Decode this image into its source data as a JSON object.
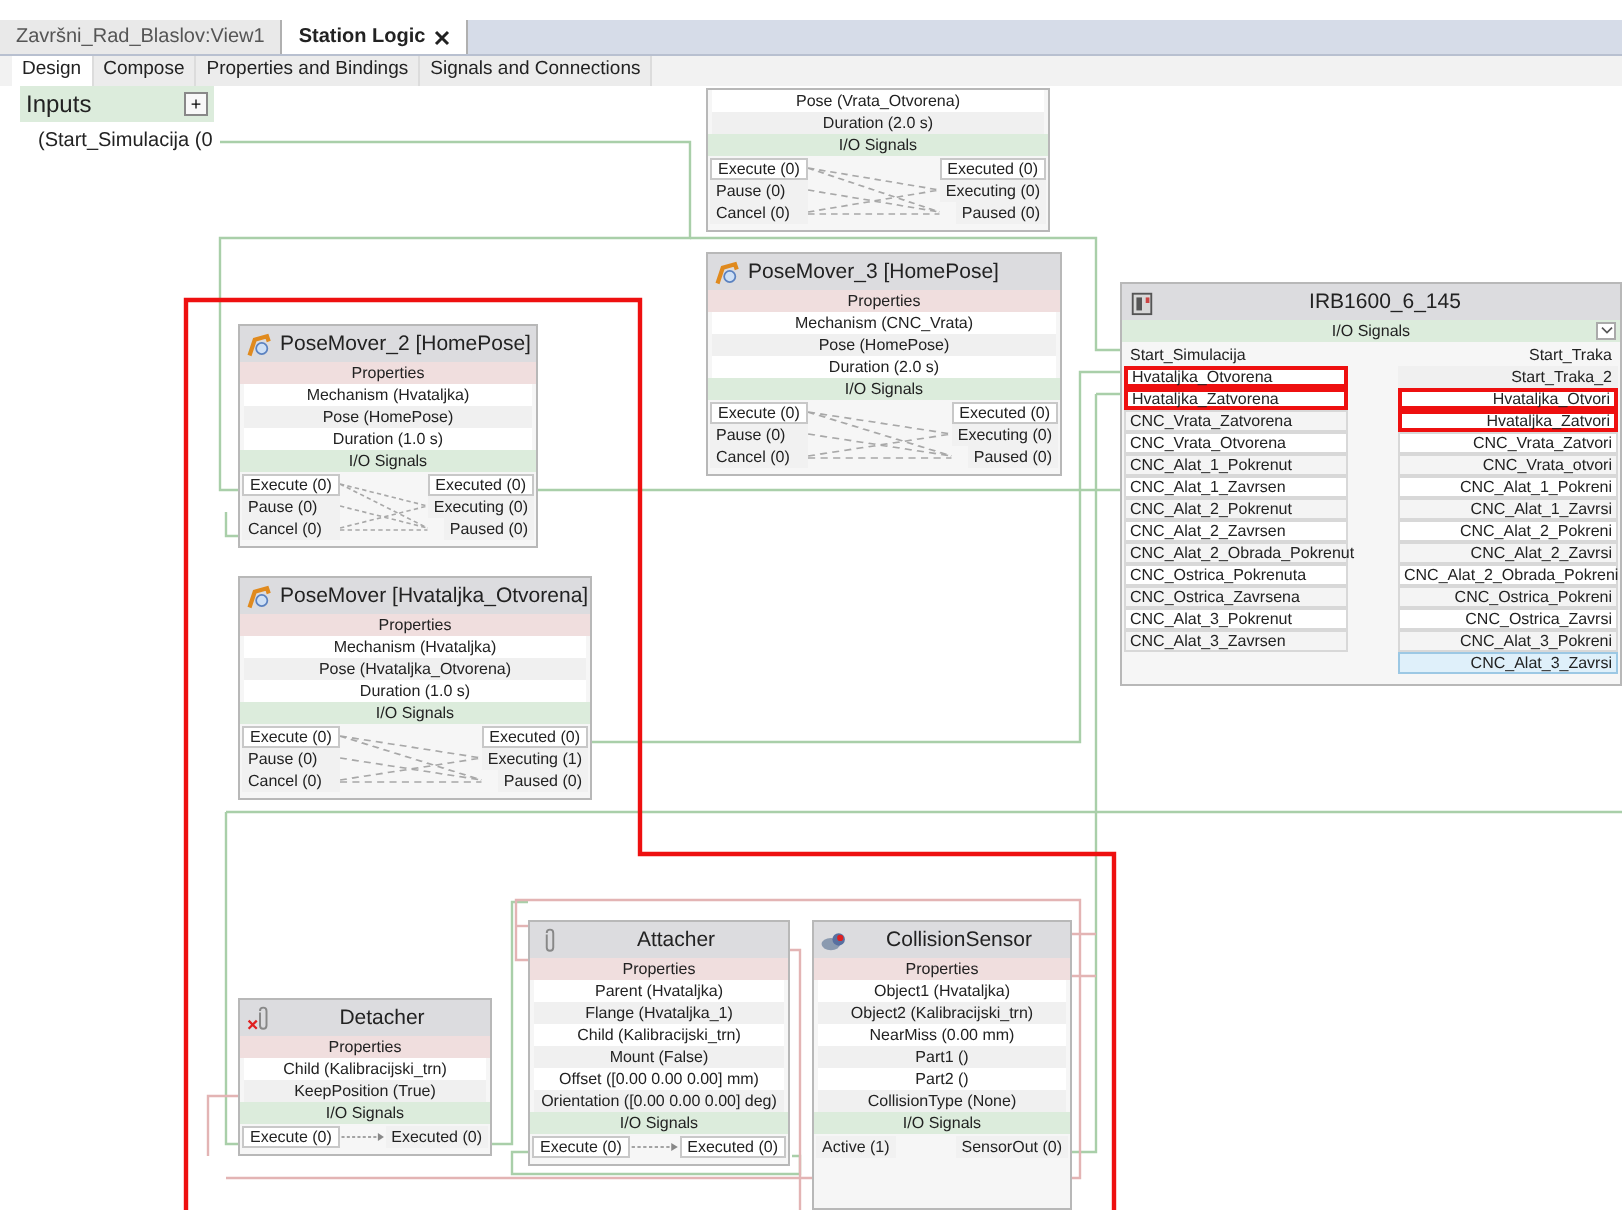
{
  "document_tabs": [
    {
      "label": "Završni_Rad_Blaslov:View1",
      "selected": false
    },
    {
      "label": "Station Logic",
      "selected": true
    }
  ],
  "view_tabs": [
    {
      "label": "Design",
      "selected": true
    },
    {
      "label": "Compose",
      "selected": false
    },
    {
      "label": "Properties and Bindings",
      "selected": false
    },
    {
      "label": "Signals and Connections",
      "selected": false
    }
  ],
  "inputs_panel": {
    "title": "Inputs",
    "add_button": "+",
    "items": [
      "(Start_Simulacija (0"
    ]
  },
  "components": [
    {
      "kind": "partial",
      "properties": [
        "Pose (Vrata_Otvorena)",
        "Duration (2.0 s)"
      ],
      "section_signals": "I/O Signals",
      "inputs": [
        "Execute (0)",
        "Pause (0)",
        "Cancel (0)"
      ],
      "outputs": [
        "Executed (0)",
        "Executing (0)",
        "Paused (0)"
      ]
    },
    {
      "kind": "posemover",
      "title": "PoseMover_3 [HomePose]",
      "section_properties": "Properties",
      "properties": [
        "Mechanism (CNC_Vrata)",
        "Pose (HomePose)",
        "Duration (2.0 s)"
      ],
      "section_signals": "I/O Signals",
      "inputs": [
        "Execute (0)",
        "Pause (0)",
        "Cancel (0)"
      ],
      "outputs": [
        "Executed (0)",
        "Executing (0)",
        "Paused (0)"
      ]
    },
    {
      "kind": "posemover",
      "title": "PoseMover_2 [HomePose]",
      "section_properties": "Properties",
      "properties": [
        "Mechanism (Hvataljka)",
        "Pose (HomePose)",
        "Duration (1.0 s)"
      ],
      "section_signals": "I/O Signals",
      "inputs": [
        "Execute (0)",
        "Pause (0)",
        "Cancel (0)"
      ],
      "outputs": [
        "Executed (0)",
        "Executing (0)",
        "Paused (0)"
      ]
    },
    {
      "kind": "posemover",
      "title": "PoseMover [Hvataljka_Otvorena]",
      "section_properties": "Properties",
      "properties": [
        "Mechanism (Hvataljka)",
        "Pose (Hvataljka_Otvorena)",
        "Duration (1.0 s)"
      ],
      "section_signals": "I/O Signals",
      "inputs": [
        "Execute (0)",
        "Pause (0)",
        "Cancel (0)"
      ],
      "outputs": [
        "Executed (0)",
        "Executing (1)",
        "Paused (0)"
      ]
    },
    {
      "kind": "detacher",
      "title": "Detacher",
      "section_properties": "Properties",
      "properties": [
        "Child (Kalibracijski_trn)",
        "KeepPosition (True)"
      ],
      "section_signals": "I/O Signals",
      "inputs": [
        "Execute (0)"
      ],
      "outputs": [
        "Executed (0)"
      ]
    },
    {
      "kind": "attacher",
      "title": "Attacher",
      "section_properties": "Properties",
      "properties": [
        "Parent (Hvataljka)",
        "Flange (Hvataljka_1)",
        "Child (Kalibracijski_trn)",
        "Mount (False)",
        "Offset ([0.00 0.00 0.00] mm)",
        "Orientation ([0.00 0.00 0.00] deg)"
      ],
      "section_signals": "I/O Signals",
      "inputs": [
        "Execute (0)"
      ],
      "outputs": [
        "Executed (0)"
      ]
    },
    {
      "kind": "sensor",
      "title": "CollisionSensor",
      "section_properties": "Properties",
      "properties": [
        "Object1 (Hvataljka)",
        "Object2 (Kalibracijski_trn)",
        "NearMiss (0.00 mm)",
        "Part1 ()",
        "Part2 ()",
        "CollisionType (None)"
      ],
      "section_signals": "I/O Signals",
      "inputs": [
        "Active (1)"
      ],
      "outputs": [
        "SensorOut (0)"
      ]
    }
  ],
  "controller": {
    "title": "IRB1600_6_145",
    "section_signals": "I/O Signals",
    "inputs": [
      {
        "label": "Start_Simulacija",
        "highlighted": false
      },
      {
        "label": "Hvataljka_Otvorena",
        "highlighted": true
      },
      {
        "label": "Hvataljka_Zatvorena",
        "highlighted": true
      },
      {
        "label": "CNC_Vrata_Zatvorena",
        "highlighted": false
      },
      {
        "label": "CNC_Vrata_Otvorena",
        "highlighted": false
      },
      {
        "label": "CNC_Alat_1_Pokrenut",
        "highlighted": false
      },
      {
        "label": "CNC_Alat_1_Zavrsen",
        "highlighted": false
      },
      {
        "label": "CNC_Alat_2_Pokrenut",
        "highlighted": false
      },
      {
        "label": "CNC_Alat_2_Zavrsen",
        "highlighted": false
      },
      {
        "label": "CNC_Alat_2_Obrada_Pokrenut",
        "highlighted": false
      },
      {
        "label": "CNC_Ostrica_Pokrenuta",
        "highlighted": false
      },
      {
        "label": "CNC_Ostrica_Zavrsena",
        "highlighted": false
      },
      {
        "label": "CNC_Alat_3_Pokrenut",
        "highlighted": false
      },
      {
        "label": "CNC_Alat_3_Zavrsen",
        "highlighted": false
      }
    ],
    "outputs": [
      {
        "label": "Start_Traka",
        "highlighted": false,
        "selected": false
      },
      {
        "label": "Start_Traka_2",
        "highlighted": false,
        "selected": false
      },
      {
        "label": "Hvataljka_Otvori",
        "highlighted": true,
        "selected": false
      },
      {
        "label": "Hvataljka_Zatvori",
        "highlighted": true,
        "selected": false
      },
      {
        "label": "CNC_Vrata_Zatvori",
        "highlighted": false,
        "selected": false
      },
      {
        "label": "CNC_Vrata_otvori",
        "highlighted": false,
        "selected": false
      },
      {
        "label": "CNC_Alat_1_Pokreni",
        "highlighted": false,
        "selected": false
      },
      {
        "label": "CNC_Alat_1_Zavrsi",
        "highlighted": false,
        "selected": false
      },
      {
        "label": "CNC_Alat_2_Pokreni",
        "highlighted": false,
        "selected": false
      },
      {
        "label": "CNC_Alat_2_Zavrsi",
        "highlighted": false,
        "selected": false
      },
      {
        "label": "CNC_Alat_2_Obrada_Pokreni",
        "highlighted": false,
        "selected": false
      },
      {
        "label": "CNC_Ostrica_Pokreni",
        "highlighted": false,
        "selected": false
      },
      {
        "label": "CNC_Ostrica_Zavrsi",
        "highlighted": false,
        "selected": false
      },
      {
        "label": "CNC_Alat_3_Pokreni",
        "highlighted": false,
        "selected": false
      },
      {
        "label": "CNC_Alat_3_Zavrsi",
        "highlighted": false,
        "selected": true
      }
    ]
  }
}
